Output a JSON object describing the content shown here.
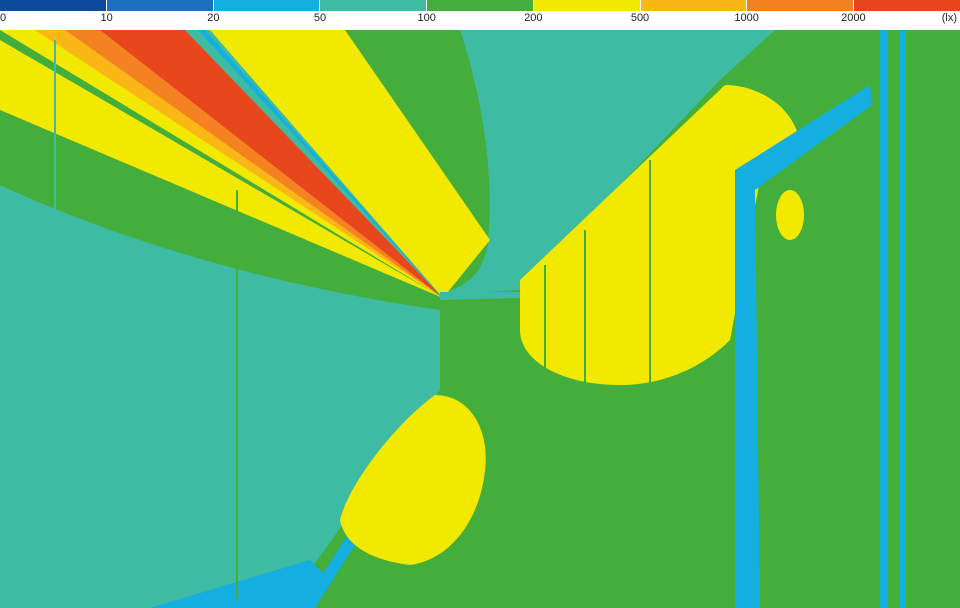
{
  "legend": {
    "colors": [
      "#0c4a9c",
      "#1a6fbf",
      "#14aee0",
      "#3dbba3",
      "#44ae3c",
      "#f2e900",
      "#fbb715",
      "#f48221",
      "#e8471e"
    ],
    "ticks": [
      "0",
      "10",
      "20",
      "50",
      "100",
      "200",
      "500",
      "1000",
      "2000"
    ],
    "unit": "(lx)"
  }
}
